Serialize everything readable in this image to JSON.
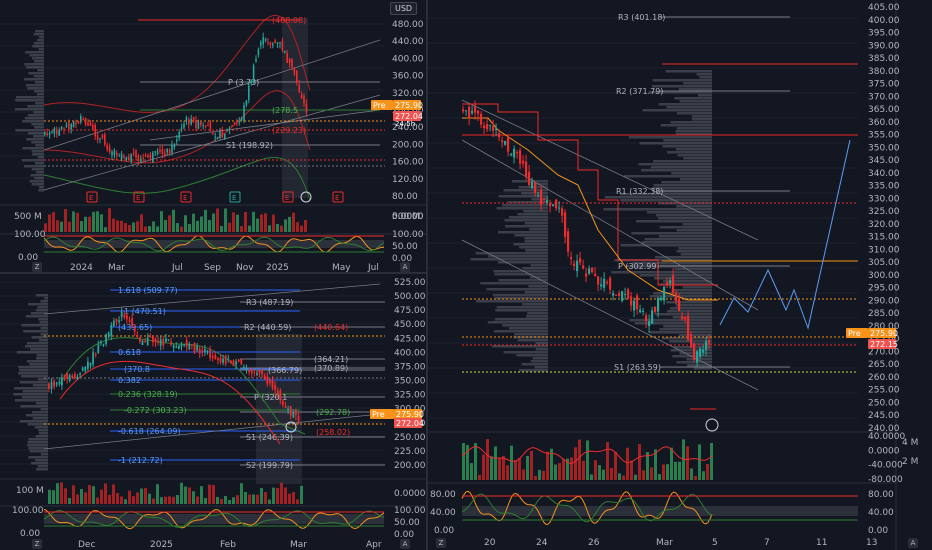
{
  "colors": {
    "bg": "#131722",
    "grid": "#1e222d",
    "up": "#26a69a",
    "up_bar": "#2e8b57",
    "down": "#ef2b2b",
    "orange": "#f7931a",
    "price_tag": "#ef5350",
    "pre_tag": "#f7931a",
    "axis_text": "#b2b5be"
  },
  "icons": {
    "tv_logo": "tradingview-logo-icon",
    "earnings_marker": "earnings-E-icon"
  },
  "currency_button": "USD",
  "pane_tl": {
    "price_axis": [
      "480.00",
      "440.00",
      "400.00",
      "360.00",
      "320.00",
      "280.00",
      "240.00",
      "200.00",
      "160.00",
      "120.00",
      "80.00"
    ],
    "ind1_axis": [
      "500 M",
      "0.0000"
    ],
    "ind2_axis": [
      "100.00",
      "50.00",
      "0.00"
    ],
    "ind2_left": [
      "100.00",
      "0.00"
    ],
    "time_axis": [
      "2024",
      "Mar",
      "Jul",
      "Sep",
      "Nov",
      "2025",
      "May",
      "Jul"
    ],
    "level_labels": [
      "(488.08)",
      "P (3",
      "73)",
      "S1 (198.92)",
      "(229.23)",
      "(278.5"
    ],
    "pre_tag": "Pre",
    "pre_value": "275.90",
    "last_value": "272.04",
    "countdown": "24:5h",
    "earnings_labels": [
      "E",
      "E",
      "E",
      "E",
      "E",
      "E"
    ],
    "corner_left": "Z",
    "corner_right": "A"
  },
  "pane_bl": {
    "price_axis": [
      "525.00",
      "500.00",
      "475.00",
      "450.00",
      "425.00",
      "400.00",
      "375.00",
      "350.00",
      "325.00",
      "300.00",
      "275.00",
      "250.00",
      "225.00",
      "200.00"
    ],
    "ind1_axis": [
      "100 M",
      "0.0000"
    ],
    "ind2_axis": [
      "100.00",
      "50.00",
      "0.00"
    ],
    "ind2_left": [
      "100.00",
      "0.00"
    ],
    "time_axis": [
      "Dec",
      "2025",
      "Feb",
      "Mar",
      "Apr"
    ],
    "fib_labels": [
      "1.618 (509.77)",
      "1 (470.51)",
      "(439.65)",
      "0.618",
      "(370.8",
      "0.382",
      "0.236 (328.19)",
      "-0.272 (303.23)",
      "-0.618 (264.09)",
      "-1 (212.72)"
    ],
    "pivot_labels": [
      "R3 (487.19)",
      "R2 (440.59)",
      "(440.64)",
      "(364.21)",
      "(370.89)",
      "(366.79)",
      "P (320.1",
      "(292.78)",
      "S1 (246.39)",
      "(258.02)",
      "S2 (199.79)"
    ],
    "pre_value": "275.90",
    "last_value": "272.04",
    "corner_left": "Z",
    "corner_right": "A"
  },
  "pane_r": {
    "price_axis": [
      "405.00",
      "400.00",
      "395.00",
      "390.00",
      "385.00",
      "380.00",
      "375.00",
      "370.00",
      "365.00",
      "360.00",
      "355.00",
      "350.00",
      "345.00",
      "340.00",
      "335.00",
      "330.00",
      "325.00",
      "320.00",
      "315.00",
      "310.00",
      "305.00",
      "300.00",
      "295.00",
      "290.00",
      "285.00",
      "280.00",
      "275.00",
      "270.00",
      "265.00",
      "260.00",
      "255.00",
      "250.00",
      "245.00",
      "240.00"
    ],
    "ind1_axis": [
      "40.0000",
      "0.0000",
      "-40.000",
      "-80.000"
    ],
    "ind1_right": [
      "4 M",
      "2 M"
    ],
    "ind2_axis": [
      "80.00",
      "40.00",
      "0.00"
    ],
    "ind2_left": [
      "80.00",
      "40.00",
      "0.00"
    ],
    "time_axis": [
      "20",
      "24",
      "26",
      "Mar",
      "5",
      "7",
      "11",
      "13"
    ],
    "pivot_labels": [
      "R3 (401.18)",
      "R2 (371.79)",
      "R1 (332.38)",
      "P (302.99)",
      "S1 (263.59)"
    ],
    "pre_tag": "Pre",
    "pre_value": "275.90",
    "last_value": "272.15",
    "corner_left": "Z",
    "corner_right": "A"
  }
}
